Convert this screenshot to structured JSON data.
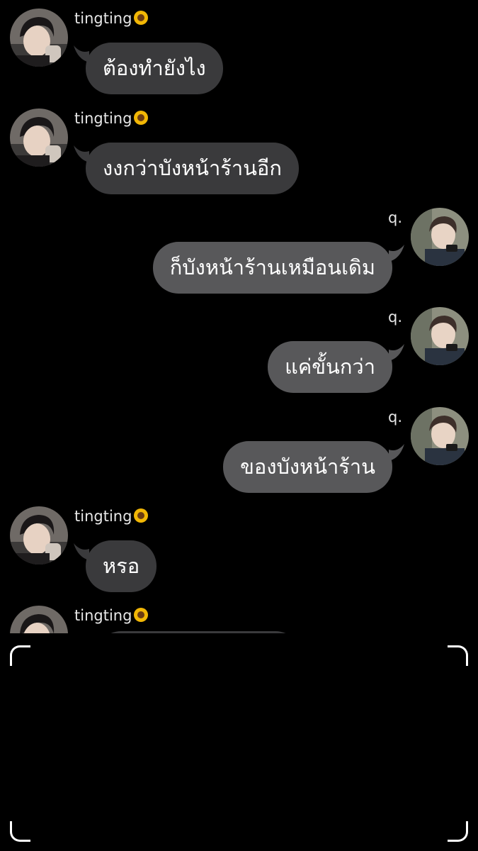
{
  "contacts": {
    "left_name": "tingting",
    "right_name": "q.",
    "left_name_suffix_icon": "sunflower-icon"
  },
  "messages": [
    {
      "sender": "tingting",
      "side": "left",
      "text": "ต้องทำยังไง"
    },
    {
      "sender": "tingting",
      "side": "left",
      "text": "งงกว่าบังหน้าร้านอีก"
    },
    {
      "sender": "q.",
      "side": "right",
      "text": "ก็บังหน้าร้านเหมือนเดิม"
    },
    {
      "sender": "q.",
      "side": "right",
      "text": "แค่ขั้นกว่า"
    },
    {
      "sender": "q.",
      "side": "right",
      "text": "ของบังหน้าร้าน"
    },
    {
      "sender": "tingting",
      "side": "left",
      "text": "หรอ"
    },
    {
      "sender": "tingting",
      "side": "left",
      "text": ""
    }
  ],
  "colors": {
    "background": "#000000",
    "bubble_left": "#3a3a3c",
    "bubble_right": "#58585a",
    "text": "#ffffff",
    "name_text": "#e6e6e6",
    "frame_corners": "#ffffff"
  }
}
